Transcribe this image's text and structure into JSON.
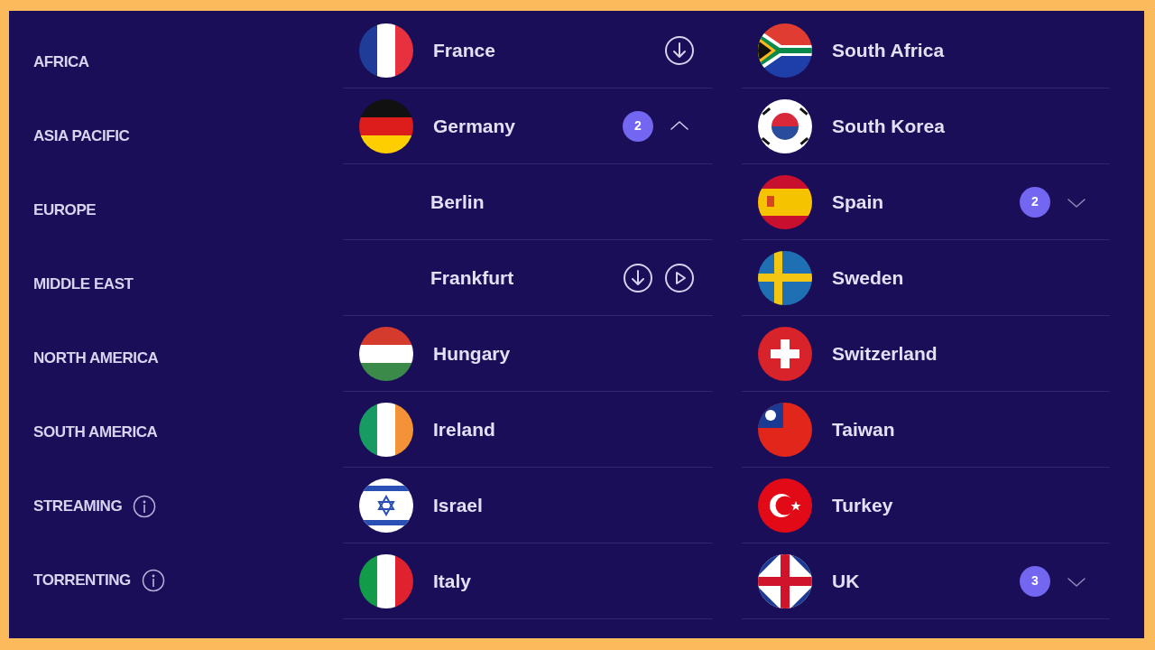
{
  "sidebar": {
    "items": [
      {
        "label": "AFRICA",
        "info": false
      },
      {
        "label": "ASIA PACIFIC",
        "info": false
      },
      {
        "label": "EUROPE",
        "info": false
      },
      {
        "label": "MIDDLE EAST",
        "info": false
      },
      {
        "label": "NORTH AMERICA",
        "info": false
      },
      {
        "label": "SOUTH AMERICA",
        "info": false
      },
      {
        "label": "STREAMING",
        "info": true
      },
      {
        "label": "TORRENTING",
        "info": true
      }
    ]
  },
  "columns": [
    {
      "rows": [
        {
          "kind": "country",
          "name": "France",
          "flag": {
            "kind": "fr"
          },
          "actions": [
            {
              "kind": "download"
            }
          ]
        },
        {
          "kind": "country",
          "name": "Germany",
          "flag": {
            "kind": "de"
          },
          "count": "2",
          "expanded": true,
          "children": [
            {
              "kind": "city",
              "name": "Berlin"
            },
            {
              "kind": "city",
              "name": "Frankfurt",
              "actions": [
                {
                  "kind": "download"
                },
                {
                  "kind": "play"
                }
              ]
            }
          ]
        },
        {
          "kind": "country",
          "name": "Hungary",
          "flag": {
            "kind": "hu"
          }
        },
        {
          "kind": "country",
          "name": "Ireland",
          "flag": {
            "kind": "ie"
          }
        },
        {
          "kind": "country",
          "name": "Israel",
          "flag": {
            "kind": "il"
          }
        },
        {
          "kind": "country",
          "name": "Italy",
          "flag": {
            "kind": "it"
          }
        }
      ]
    },
    {
      "rows": [
        {
          "kind": "country",
          "name": "South Africa",
          "flag": {
            "kind": "za"
          }
        },
        {
          "kind": "country",
          "name": "South Korea",
          "flag": {
            "kind": "kr"
          }
        },
        {
          "kind": "country",
          "name": "Spain",
          "flag": {
            "kind": "es"
          },
          "count": "2",
          "expanded": false
        },
        {
          "kind": "country",
          "name": "Sweden",
          "flag": {
            "kind": "se"
          }
        },
        {
          "kind": "country",
          "name": "Switzerland",
          "flag": {
            "kind": "ch"
          }
        },
        {
          "kind": "country",
          "name": "Taiwan",
          "flag": {
            "kind": "tw"
          }
        },
        {
          "kind": "country",
          "name": "Turkey",
          "flag": {
            "kind": "tr"
          }
        },
        {
          "kind": "country",
          "name": "UK",
          "flag": {
            "kind": "gb"
          },
          "count": "3",
          "expanded": false
        }
      ]
    }
  ]
}
